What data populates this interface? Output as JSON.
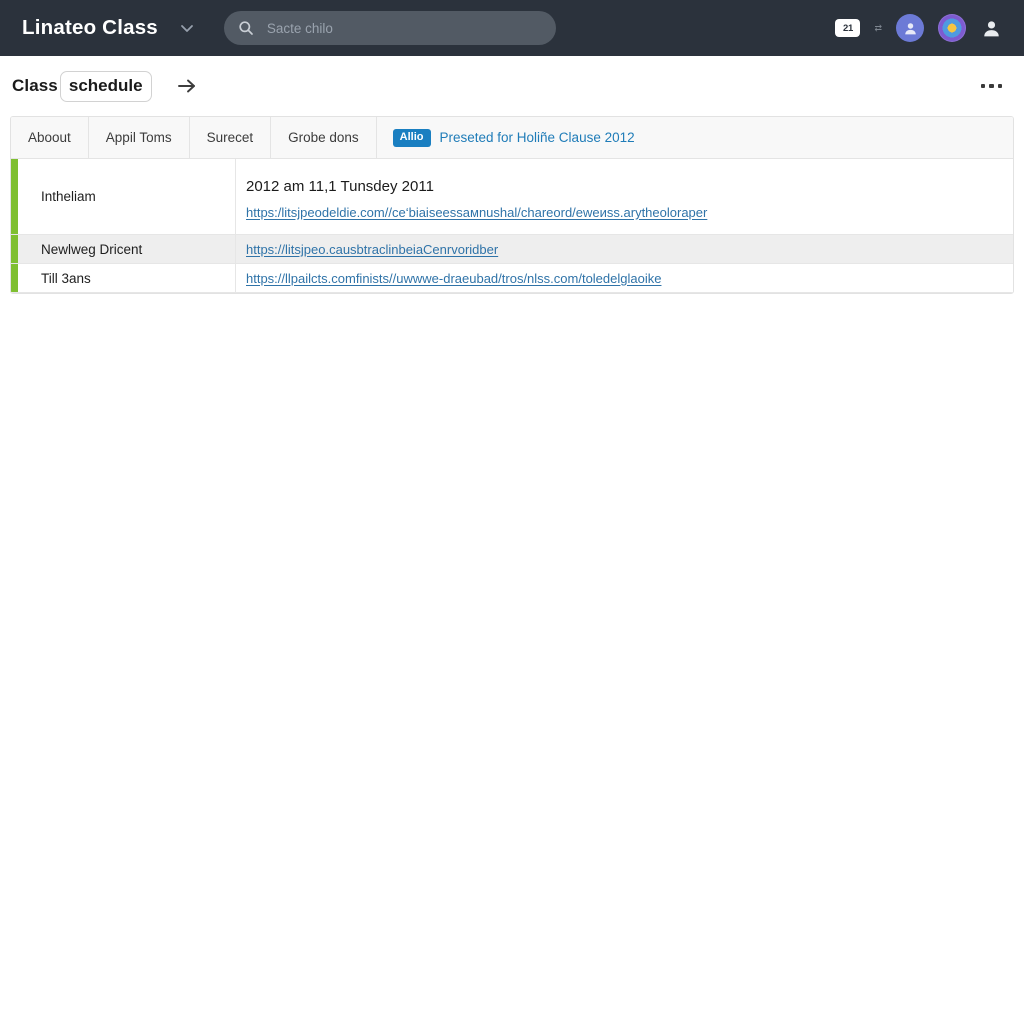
{
  "topbar": {
    "brand": "Linateo Class",
    "brand_caret_icon": "chevron-down-icon",
    "search": {
      "icon": "search-icon",
      "placeholder": "Sacte chilo",
      "value": ""
    },
    "right": {
      "cam_badge_label": "21",
      "cam_badge_icon": "video-camera-badge-icon",
      "mini_glyph": "⇄",
      "avatar_user_icon": "user-avatar-icon",
      "avatar_profile_icon": "profile-photo-icon",
      "person_icon": "person-icon"
    }
  },
  "pagehead": {
    "title_prefix": "Class ",
    "title_chip": "schedule",
    "arrow_icon": "arrow-right-icon",
    "overflow_icon": "more-options-icon"
  },
  "panel": {
    "tabs": [
      {
        "label": "Aboout"
      },
      {
        "label": "Appil Toms"
      },
      {
        "label": "Surecet"
      },
      {
        "label": "Grobe dons"
      }
    ],
    "note": {
      "badge": "Allio",
      "text": "Preseted for  Holiñe Clause 2012"
    },
    "rows": [
      {
        "label": "Intheliam",
        "date": "2012 am 11,1 Tunsdеy 2011",
        "links": [
          "https:/litsjpeodeldie.com//ce‘biaiseessамnushal/chareord/eweиss.arytheoloraper"
        ],
        "accent": "#7fbf31",
        "alt": false
      },
      {
        "label": "Newlweg Dricent",
        "date": "",
        "links": [
          "https://litsjpeo.causbtraclinbeiаСenrvoridber"
        ],
        "accent": "#7fbf31",
        "alt": true
      },
      {
        "label": "Till 3ans",
        "date": "",
        "links": [
          "https://llpailcts.comfinists//uwwwe-draeubad/tros/nlss.com/toledelglaoike"
        ],
        "accent": "#7fbf31",
        "alt": false
      }
    ]
  },
  "colors": {
    "topbar_bg": "#2b323c",
    "search_bg": "#525a64",
    "accent_green": "#7fbf31",
    "badge_blue": "#1a7fc1",
    "link_blue": "#2f73a8",
    "panel_border": "#e2e2e2"
  }
}
